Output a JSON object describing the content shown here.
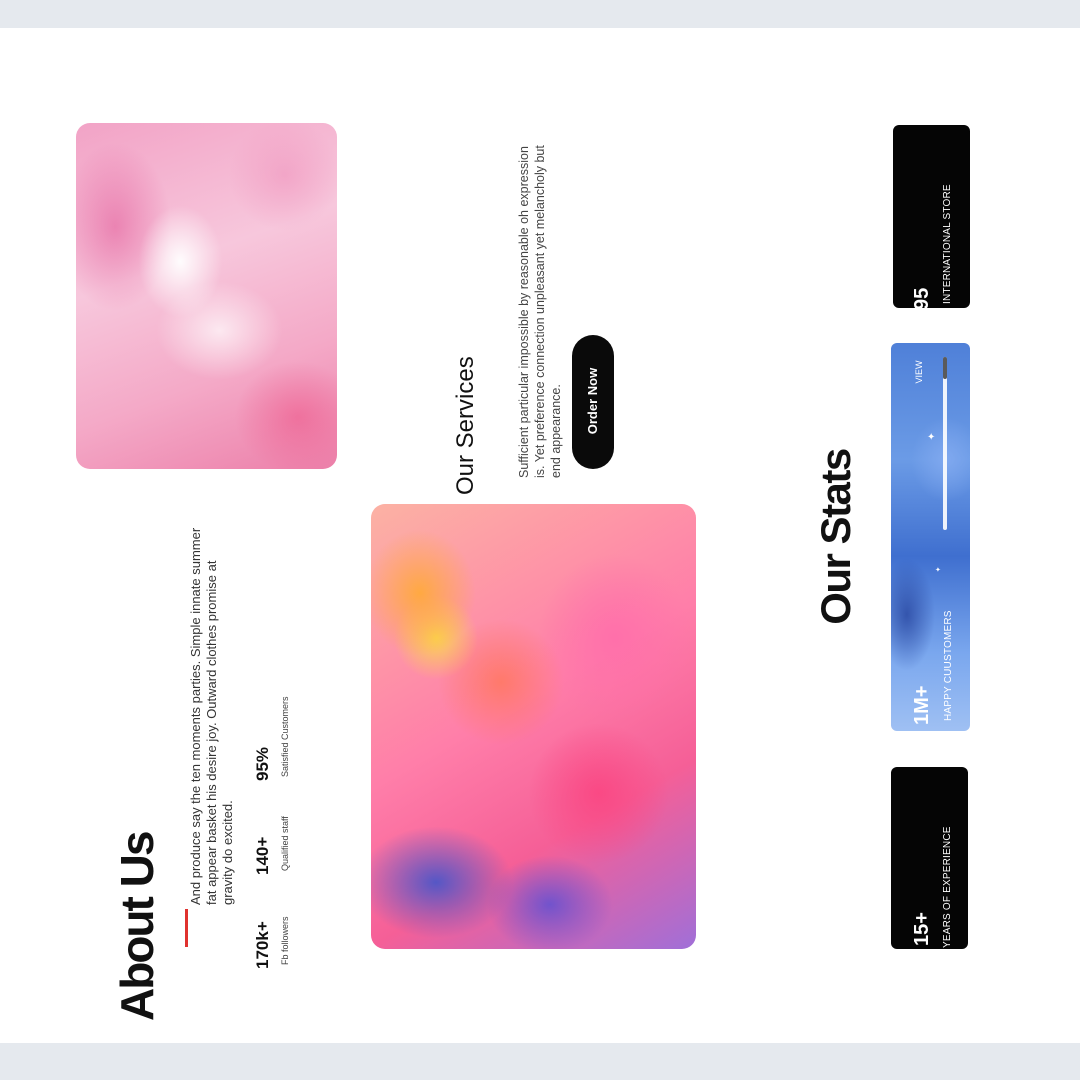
{
  "about": {
    "title": "About Us",
    "text": "And produce say the ten moments parties. Simple innate summer fat appear basket his desire joy. Outward clothes promise at gravity do excited.",
    "stats": [
      {
        "value": "170k+",
        "label": "Fb followers"
      },
      {
        "value": "140+",
        "label": "Qualified staff"
      },
      {
        "value": "95%",
        "label": "Satisfied Customers"
      }
    ]
  },
  "services": {
    "title": "Our Services",
    "text": "Sufficient particular impossible by reasonable oh expression is. Yet preference connection unpleasant yet melancholy but end appearance.",
    "button": "Order Now"
  },
  "stats": {
    "title": "Our Stats",
    "cards": [
      {
        "value": "95",
        "label": "INTERNATIONAL STORE"
      },
      {
        "value": "1M+",
        "label": "HAPPY CUUSTOMERS",
        "view_label": "VIEW"
      },
      {
        "value": "15+",
        "label": "YEARS OF EXPERIENCE"
      }
    ]
  },
  "colors": {
    "accent": "#e0322f",
    "dark_card": "#050505",
    "band": "#e5e9ee"
  }
}
